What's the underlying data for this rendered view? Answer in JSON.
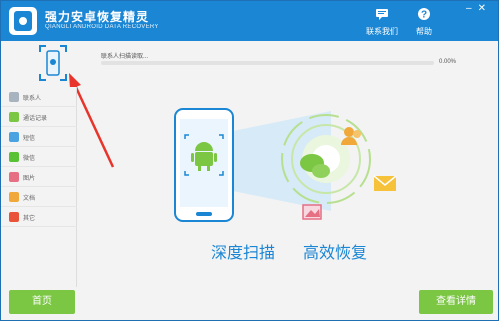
{
  "app": {
    "title": "强力安卓恢复精灵",
    "subtitle": "QIANGLI ANDROID DATA RECOVERY"
  },
  "toolbar": {
    "contact_label": "联系我们",
    "help_label": "帮助"
  },
  "scan": {
    "status_text": "联系人扫描读取...",
    "percent_text": "0.00%",
    "progress": 0.0
  },
  "sidebar": {
    "items": [
      {
        "label": "联系人",
        "icon": "contacts-icon",
        "color": "#a8b3c0"
      },
      {
        "label": "通话记录",
        "icon": "phone-icon",
        "color": "#7bc643"
      },
      {
        "label": "短信",
        "icon": "message-icon",
        "color": "#4aa3e0"
      },
      {
        "label": "微信",
        "icon": "wechat-icon",
        "color": "#58c234"
      },
      {
        "label": "图片",
        "icon": "image-icon",
        "color": "#e66f84"
      },
      {
        "label": "文档",
        "icon": "document-icon",
        "color": "#f1a83a"
      },
      {
        "label": "其它",
        "icon": "more-icon",
        "color": "#e8533a"
      }
    ]
  },
  "hero": {
    "caption_left": "深度扫描",
    "caption_right": "高效恢复"
  },
  "buttons": {
    "home_label": "首页",
    "details_label": "查看详情"
  },
  "colors": {
    "titlebar": "#1a86d4",
    "accent_green": "#7bc643",
    "accent_blue": "#1a86d4"
  }
}
